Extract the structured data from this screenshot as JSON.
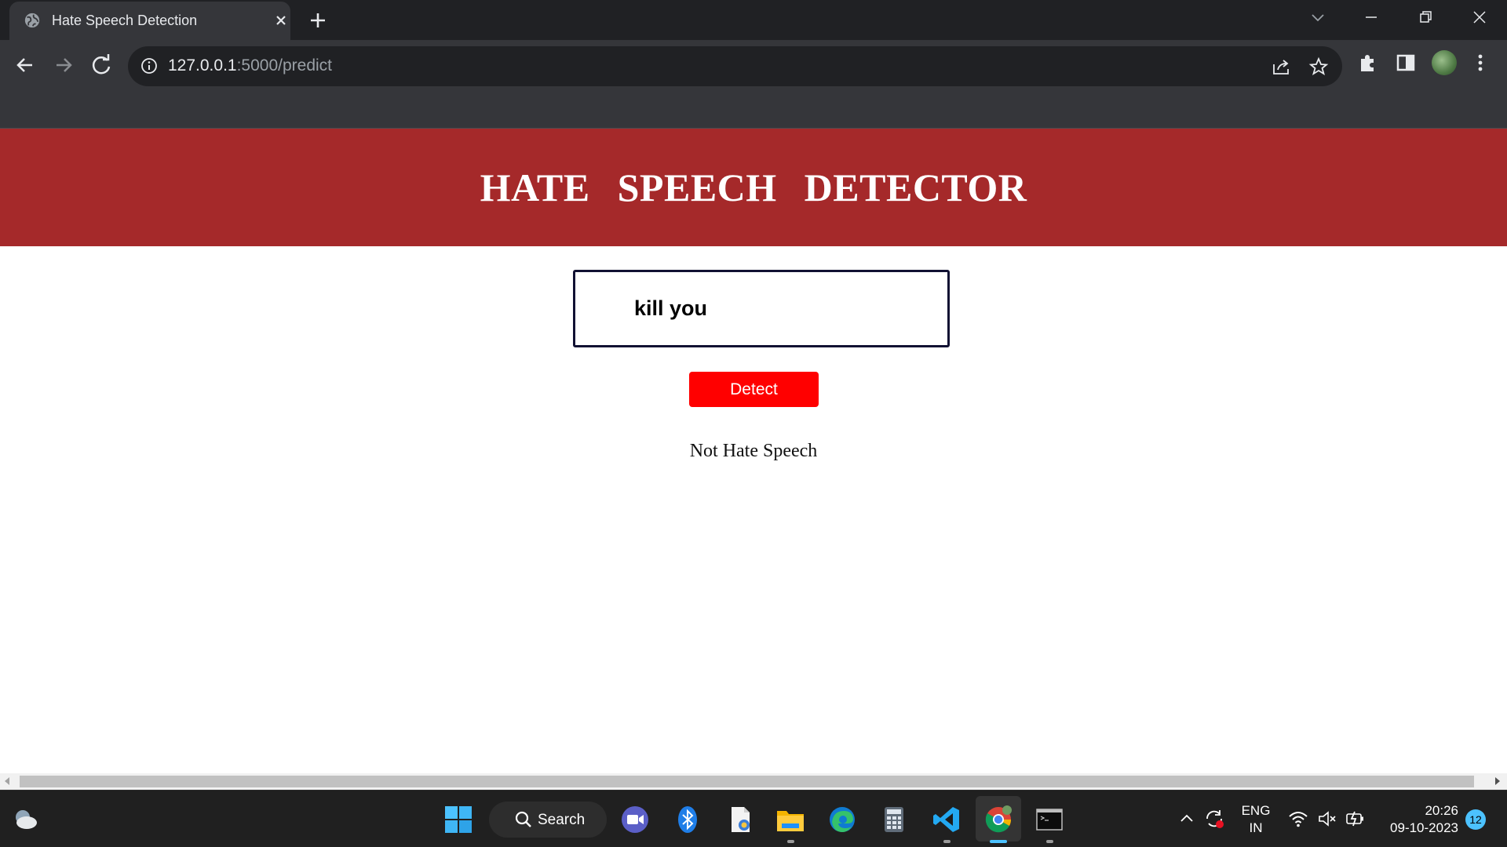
{
  "browser": {
    "tab_title": "Hate Speech Detection",
    "url_host": "127.0.0.1",
    "url_rest": ":5000/predict"
  },
  "page": {
    "heading": "HATE SPEECH DETECTOR",
    "input_value": "kill you",
    "button_label": "Detect",
    "result_text": "Not Hate Speech"
  },
  "taskbar": {
    "search_label": "Search",
    "lang_line1": "ENG",
    "lang_line2": "IN",
    "time": "20:26",
    "date": "09-10-2023",
    "notification_count": "12"
  },
  "colors": {
    "header_bg": "#a5292a",
    "button_bg": "#ff0000",
    "chrome_dark": "#202124",
    "chrome_toolbar": "#35363a",
    "taskbar_bg": "#202020",
    "accent": "#4cc2ff"
  }
}
